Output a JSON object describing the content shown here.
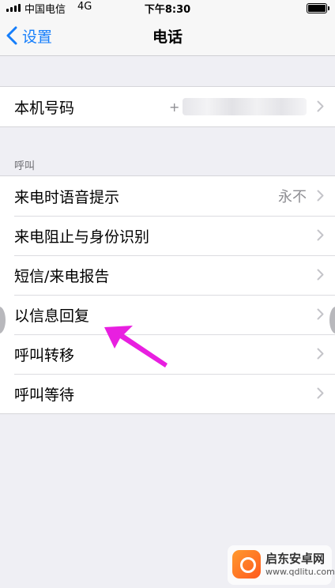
{
  "status_bar": {
    "carrier": "中国电信",
    "network": "4G",
    "time": "下午8:30"
  },
  "nav": {
    "back_label": "设置",
    "title": "电话"
  },
  "group1": {
    "rows": [
      {
        "label": "本机号码",
        "value_prefix": "+"
      }
    ]
  },
  "section_calls": {
    "header": "呼叫",
    "rows": [
      {
        "label": "来电时语音提示",
        "value": "永不"
      },
      {
        "label": "来电阻止与身份识别"
      },
      {
        "label": "短信/来电报告"
      },
      {
        "label": "以信息回复"
      },
      {
        "label": "呼叫转移"
      },
      {
        "label": "呼叫等待"
      }
    ]
  },
  "watermark": {
    "name": "启东安卓网",
    "url": "www.qdlitu.com"
  },
  "colors": {
    "accent": "#157efb",
    "arrow": "#e81fe0",
    "background": "#efeff4"
  },
  "icons": {
    "back": "chevron-left-icon",
    "row": "chevron-right-icon"
  }
}
